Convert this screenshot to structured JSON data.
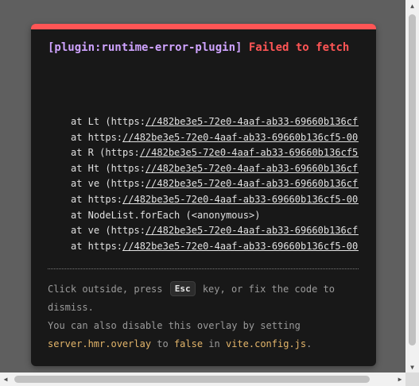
{
  "overlay": {
    "plugin": "[plugin:runtime-error-plugin]",
    "message": "Failed to fetch",
    "stack": [
      {
        "prefix": "at Lt (https:",
        "url": "//482be3e5-72e0-4aaf-ab33-69660b136cf5"
      },
      {
        "prefix": "at https:",
        "url": "//482be3e5-72e0-4aaf-ab33-69660b136cf5-00-"
      },
      {
        "prefix": "at R (https:",
        "url": "//482be3e5-72e0-4aaf-ab33-69660b136cf5-"
      },
      {
        "prefix": "at Ht (https:",
        "url": "//482be3e5-72e0-4aaf-ab33-69660b136cf5"
      },
      {
        "prefix": "at ve (https:",
        "url": "//482be3e5-72e0-4aaf-ab33-69660b136cf5"
      },
      {
        "prefix": "at https:",
        "url": "//482be3e5-72e0-4aaf-ab33-69660b136cf5-00-"
      },
      {
        "prefix": "at NodeList.forEach (<anonymous>)",
        "url": ""
      },
      {
        "prefix": "at ve (https:",
        "url": "//482be3e5-72e0-4aaf-ab33-69660b136cf5"
      },
      {
        "prefix": "at https:",
        "url": "//482be3e5-72e0-4aaf-ab33-69660b136cf5-00-"
      }
    ],
    "tip": {
      "part1": "Click outside, press ",
      "key": "Esc",
      "part2": " key, or fix the code to dismiss.",
      "line2": "You can also disable this overlay by setting",
      "code1": "server.hmr.overlay",
      "to": " to ",
      "code2": "false",
      "in": " in ",
      "code3": "vite.config.js",
      "end": "."
    }
  },
  "colors": {
    "accent": "#ff5555",
    "plugin": "#cfa3ff",
    "code": "#e3b56a",
    "background": "#181818"
  }
}
